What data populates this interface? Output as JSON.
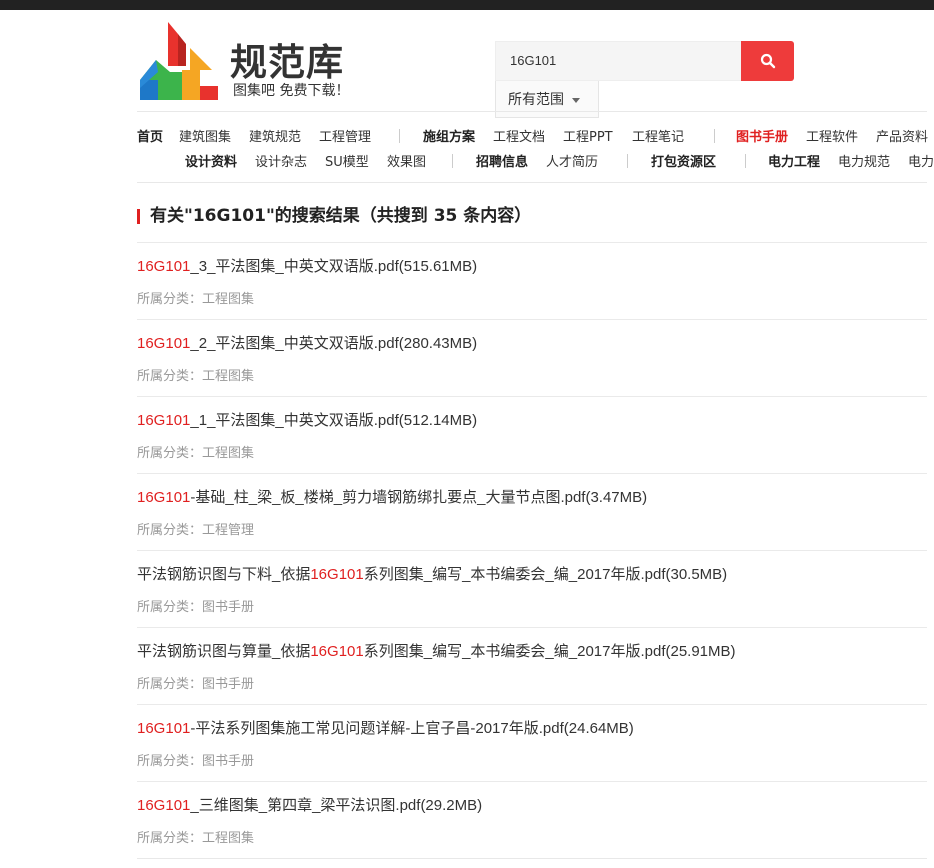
{
  "logo": {
    "title": "规范库",
    "subtitle": "图集吧  免费下载！"
  },
  "search": {
    "query": "16G101",
    "button_icon": "search-icon",
    "scope_label": "所有范围"
  },
  "nav": {
    "row1": [
      {
        "label": "首页",
        "style": "bold"
      },
      {
        "label": "建筑图集"
      },
      {
        "label": "建筑规范"
      },
      {
        "label": "工程管理"
      },
      {
        "label": "施组方案",
        "style": "bold"
      },
      {
        "label": "工程文档"
      },
      {
        "label": "工程PPT"
      },
      {
        "label": "工程笔记"
      },
      {
        "label": "图书手册",
        "style": "red"
      },
      {
        "label": "工程软件"
      },
      {
        "label": "产品资料"
      }
    ],
    "row2": [
      {
        "label": "设计资料",
        "style": "bold"
      },
      {
        "label": "设计杂志"
      },
      {
        "label": "SU模型"
      },
      {
        "label": "效果图"
      },
      {
        "label": "招聘信息",
        "style": "bold"
      },
      {
        "label": "人才简历"
      },
      {
        "label": "打包资源区",
        "style": "bold"
      },
      {
        "label": "电力工程",
        "style": "bold"
      },
      {
        "label": "电力规范"
      },
      {
        "label": "电力"
      }
    ]
  },
  "heading": "有关\"16G101\"的搜索结果（共搜到 35 条内容）",
  "category_prefix": "所属分类：",
  "results": [
    {
      "pre": "",
      "hl": "16G101",
      "post": "_3_平法图集_中英文双语版.pdf(515.61MB)",
      "category": "工程图集"
    },
    {
      "pre": "",
      "hl": "16G101",
      "post": "_2_平法图集_中英文双语版.pdf(280.43MB)",
      "category": "工程图集"
    },
    {
      "pre": "",
      "hl": "16G101",
      "post": "_1_平法图集_中英文双语版.pdf(512.14MB)",
      "category": "工程图集"
    },
    {
      "pre": "",
      "hl": "16G101",
      "post": "-基础_柱_梁_板_楼梯_剪力墙钢筋绑扎要点_大量节点图.pdf(3.47MB)",
      "category": "工程管理"
    },
    {
      "pre": "平法钢筋识图与下料_依据",
      "hl": "16G101",
      "post": "系列图集_编写_本书编委会_编_2017年版.pdf(30.5MB)",
      "category": "图书手册"
    },
    {
      "pre": "平法钢筋识图与算量_依据",
      "hl": "16G101",
      "post": "系列图集_编写_本书编委会_编_2017年版.pdf(25.91MB)",
      "category": "图书手册"
    },
    {
      "pre": "",
      "hl": "16G101",
      "post": "-平法系列图集施工常见问题详解-上官子昌-2017年版.pdf(24.64MB)",
      "category": "图书手册"
    },
    {
      "pre": "",
      "hl": "16G101",
      "post": "_三维图集_第四章_梁平法识图.pdf(29.2MB)",
      "category": "工程图集"
    }
  ],
  "colors": {
    "accent_red": "#e02020",
    "search_button": "#ee3b3b",
    "logo_red": "#e8322d",
    "logo_orange": "#f5a623",
    "logo_green": "#3cb44b",
    "logo_blue": "#1e78c8"
  }
}
